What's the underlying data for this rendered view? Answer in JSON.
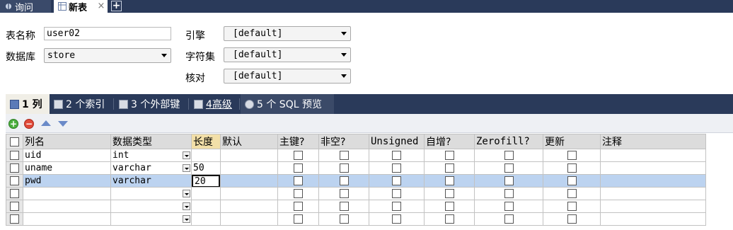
{
  "doc_tabs": {
    "query_label": "询问",
    "new_label": "新表",
    "close": "×",
    "add": "+"
  },
  "form": {
    "table_name_label": "表名称",
    "table_name_value": "user02",
    "database_label": "数据库",
    "database_value": "store",
    "engine_label": "引擎",
    "engine_value": "[default]",
    "charset_label": "字符集",
    "charset_value": "[default]",
    "collation_label": "核对",
    "collation_value": "[default]"
  },
  "inner_tabs": [
    {
      "label": "1 列"
    },
    {
      "label": "2 个索引"
    },
    {
      "label": "3 个外部键"
    },
    {
      "label": "4高级"
    },
    {
      "label": "5 个 SQL 预览"
    }
  ],
  "grid": {
    "headers": [
      "列名",
      "数据类型",
      "长度",
      "默认",
      "主键?",
      "非空?",
      "Unsigned",
      "自增?",
      "Zerofill?",
      "更新",
      "注释"
    ],
    "rows": [
      {
        "name": "uid",
        "type": "int",
        "length": "",
        "default": ""
      },
      {
        "name": "uname",
        "type": "varchar",
        "length": "50",
        "default": ""
      },
      {
        "name": "pwd",
        "type": "varchar",
        "length": "20",
        "default": ""
      },
      {
        "name": "",
        "type": "",
        "length": "",
        "default": ""
      },
      {
        "name": "",
        "type": "",
        "length": "",
        "default": ""
      },
      {
        "name": "",
        "type": "",
        "length": "",
        "default": ""
      }
    ]
  },
  "colors": {
    "dark_bar": "#2a3a5a",
    "selected_row": "#bcd3f0"
  }
}
